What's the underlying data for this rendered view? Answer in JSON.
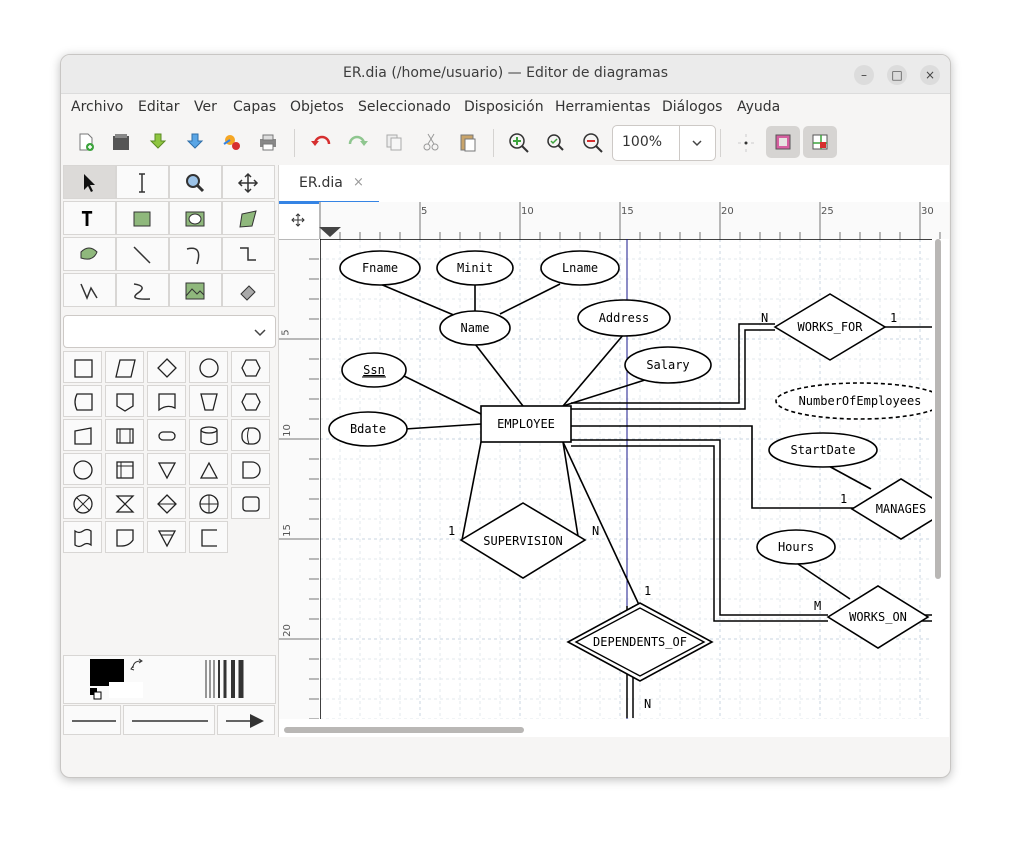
{
  "window": {
    "title": "ER.dia (/home/usuario) — Editor de diagramas",
    "controls": {
      "minimize": "–",
      "maximize": "□",
      "close": "×"
    }
  },
  "menu": [
    "Archivo",
    "Editar",
    "Ver",
    "Capas",
    "Objetos",
    "Seleccionado",
    "Disposición",
    "Herramientas",
    "Diálogos",
    "Ayuda"
  ],
  "toolbar": {
    "zoom_value": "100%",
    "icons": [
      "new-document-icon",
      "open-icon",
      "save-icon",
      "save-as-icon",
      "export-icon",
      "print-icon",
      "undo-icon",
      "redo-icon",
      "copy-icon",
      "cut-icon",
      "paste-icon",
      "zoom-in-icon",
      "zoom-fit-icon",
      "zoom-out-icon",
      "snap-grid-icon",
      "snap-object-icon",
      "guide-icon"
    ]
  },
  "toolbox": {
    "tools": [
      "pointer",
      "text-edit",
      "magnify",
      "scroll",
      "text",
      "box",
      "ellipse",
      "polygon",
      "beziergon",
      "line",
      "arc",
      "zigzag",
      "polyline",
      "bezier",
      "image",
      "outline"
    ],
    "sheet_value": ""
  },
  "tab": {
    "label": "ER.dia",
    "close": "×"
  },
  "ruler": {
    "top_labels": [
      "5",
      "10",
      "15",
      "20",
      "25",
      "30"
    ],
    "left_labels": [
      "5",
      "10",
      "15",
      "20"
    ]
  },
  "colors": {
    "accent": "#3584e4",
    "fg": "#000000",
    "bg": "#ffffff"
  },
  "diagram": {
    "entities": [
      "EMPLOYEE"
    ],
    "attributes": [
      "Fname",
      "Minit",
      "Lname",
      "Name",
      "Address",
      "Ssn",
      "Salary",
      "Bdate",
      "StartDate",
      "Hours"
    ],
    "derived_attributes": [
      "NumberOfEmployees"
    ],
    "relationships": [
      "WORKS_FOR",
      "MANAGES",
      "WORKS_ON",
      "SUPERVISION"
    ],
    "identifying_relationships": [
      "DEPENDENTS_OF"
    ],
    "cardinalities": {
      "works_for_left": "N",
      "works_for_right": "1",
      "manages": "1",
      "works_on": "M",
      "supervision_1": "1",
      "supervision_n": "N",
      "dependents_1": "1",
      "dependents_n": "N"
    }
  }
}
